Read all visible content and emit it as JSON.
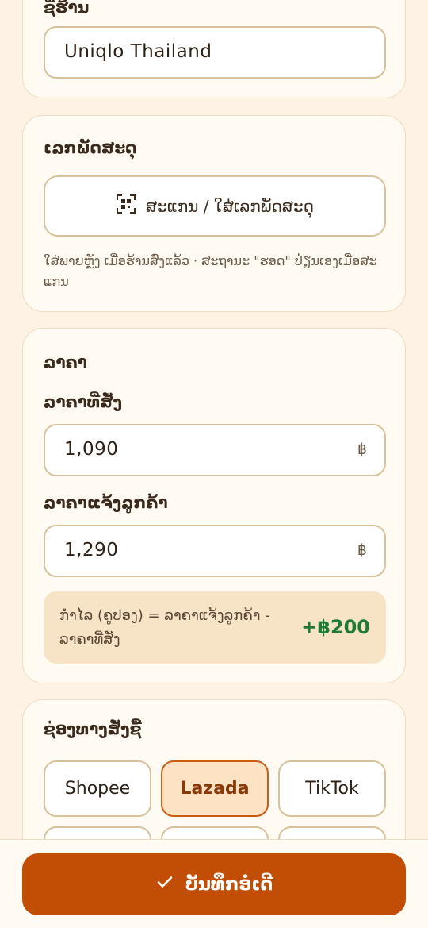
{
  "shop": {
    "label": "ຊື່ຮ້ານ",
    "value": "Uniqlo Thailand"
  },
  "tracking": {
    "label": "ເລກພັດສະດຸ",
    "scan_button": "ສະແກນ / ໃສ່ເລກພັດສະດຸ",
    "hint": "ໃສ່ພາຍຫຼັງ ເມື່ອຮ້ານສົ່ງແລ້ວ · ສະຖານະ \"ຮອດ\" ປ່ຽນເອງເມື່ອສະແກນ"
  },
  "price": {
    "section_label": "ລາຄາ",
    "cost_label": "ລາຄາທີ່ສັ່ງ",
    "cost_value": "1,090",
    "cost_currency": "฿",
    "sell_label": "ລາຄາແຈ້ງລູກຄ້າ",
    "sell_value": "1,290",
    "sell_currency": "฿",
    "profit_formula": "ກຳໄລ (ຄູປອງ) = ລາຄາແຈ້ງລູກຄ້າ - ລາຄາທີ່ສັ່ງ",
    "profit_value": "+฿200"
  },
  "channel": {
    "label": "ຊ່ອງທາງສັ່ງຊື້",
    "options": [
      "Shopee",
      "Lazada",
      "TikTok"
    ],
    "selected": "Lazada"
  },
  "save": {
    "label": "ບັນທຶກອໍເດີ"
  },
  "colors": {
    "background": "#fdf2e3",
    "accent": "#c24e05",
    "profit": "#1f7a35",
    "selected_chip": "#fde3c4"
  },
  "icons": {
    "scan": "qr-scan-icon",
    "save": "check-icon"
  }
}
